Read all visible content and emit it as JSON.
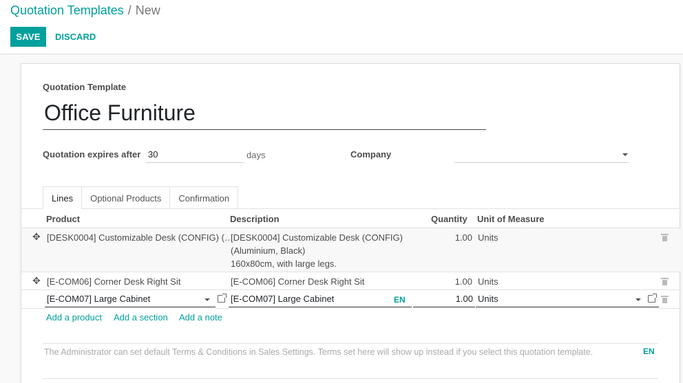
{
  "breadcrumb": {
    "parent": "Quotation Templates",
    "separator": "/",
    "current": "New"
  },
  "toolbar": {
    "save_label": "SAVE",
    "discard_label": "DISCARD"
  },
  "form": {
    "name_label": "Quotation Template",
    "name_value": "Office Furniture",
    "expires_label": "Quotation expires after",
    "expires_value": "30",
    "expires_unit": "days",
    "company_label": "Company",
    "company_value": ""
  },
  "tabs": [
    {
      "label": "Lines",
      "active": true
    },
    {
      "label": "Optional Products",
      "active": false
    },
    {
      "label": "Confirmation",
      "active": false
    }
  ],
  "table": {
    "headers": {
      "product": "Product",
      "description": "Description",
      "quantity": "Quantity",
      "uom": "Unit of Measure"
    },
    "rows": [
      {
        "product": "[DESK0004] Customizable Desk (CONFIG) (…",
        "description_lines": [
          "[DESK0004] Customizable Desk (CONFIG)",
          "(Aluminium, Black)",
          "160x80cm, with large legs."
        ],
        "quantity": "1.00",
        "uom": "Units"
      },
      {
        "product": "[E-COM06] Corner Desk Right Sit",
        "description_lines": [
          "[E-COM06] Corner Desk Right Sit"
        ],
        "quantity": "1.00",
        "uom": "Units"
      },
      {
        "product": "[E-COM07] Large Cabinet",
        "description_lines": [
          "[E-COM07] Large Cabinet"
        ],
        "quantity": "1.00",
        "uom": "Units",
        "lang": "EN",
        "editing": true
      }
    ],
    "actions": {
      "add_product": "Add a product",
      "add_section": "Add a section",
      "add_note": "Add a note"
    }
  },
  "notes": {
    "placeholder": "The Administrator can set default Terms & Conditions in Sales Settings. Terms set here will show up instead if you select this quotation template.",
    "lang": "EN"
  },
  "colors": {
    "accent": "#00a09d",
    "text": "#4c4c4c",
    "border": "#dee2e6"
  },
  "icons": [
    "drag-handle-icon",
    "trash-icon",
    "external-link-icon",
    "caret-down-icon"
  ]
}
